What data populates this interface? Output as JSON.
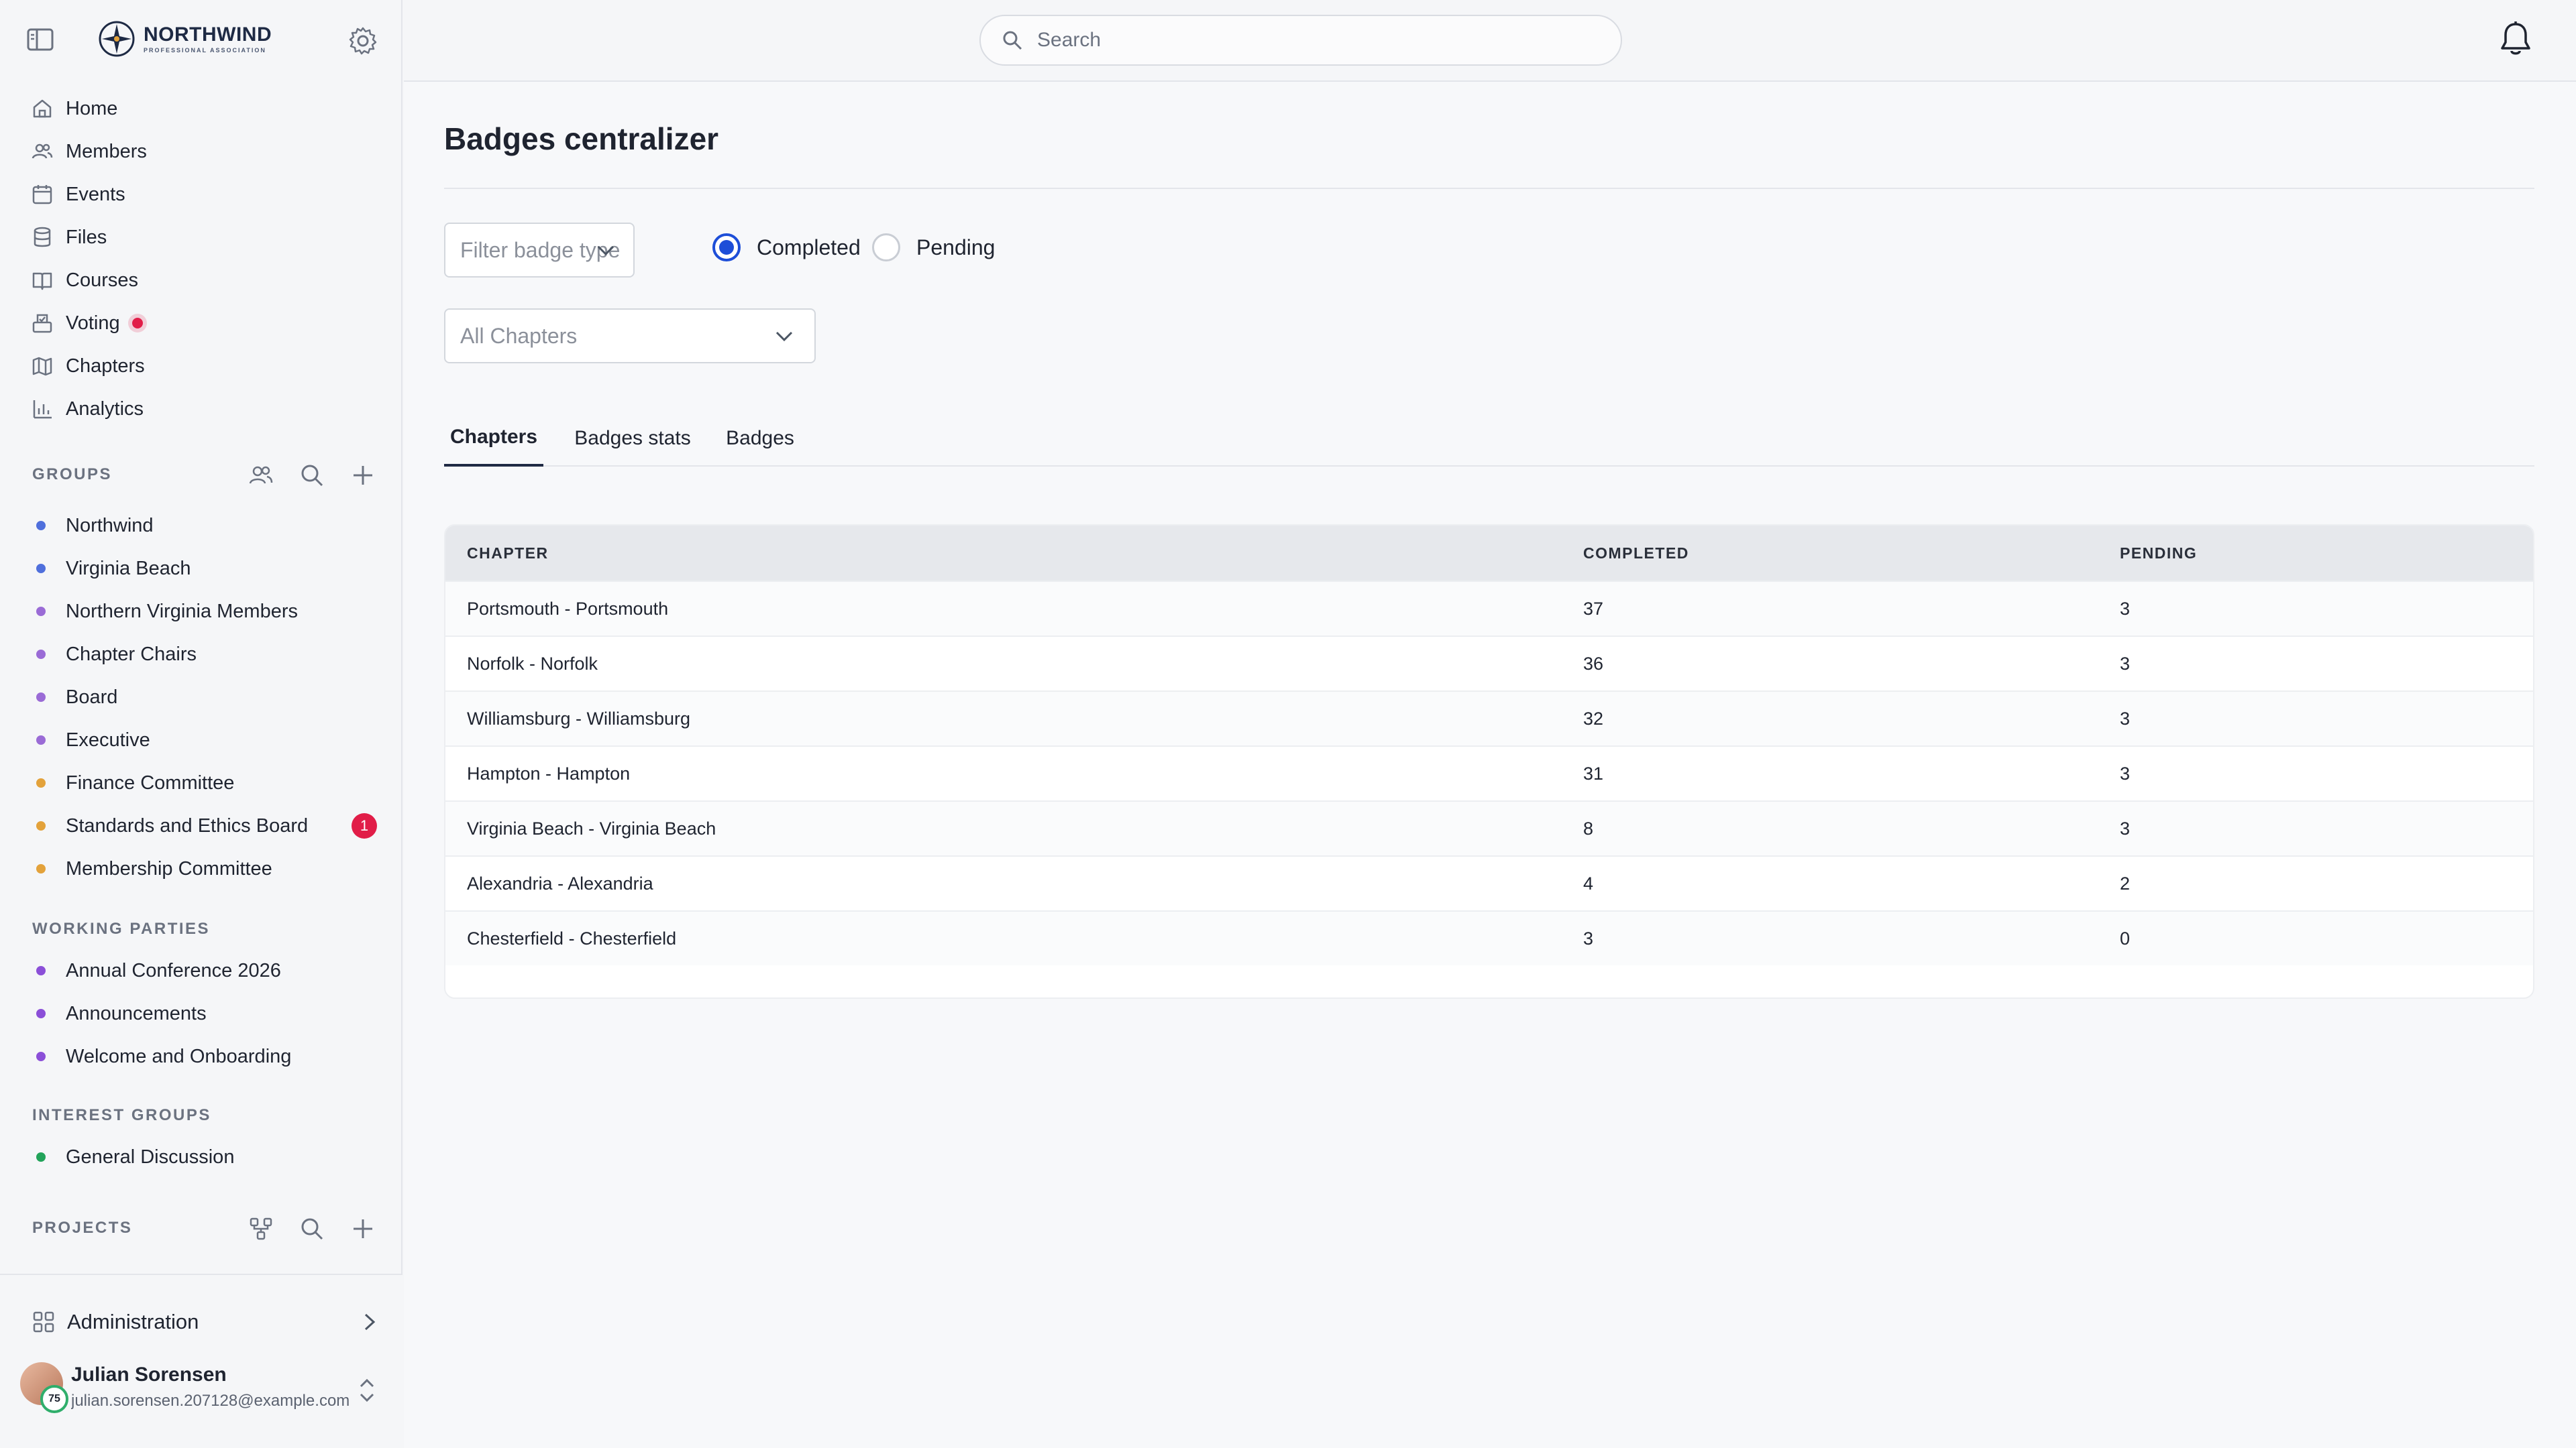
{
  "brand": {
    "name": "NORTHWIND",
    "subtitle": "PROFESSIONAL ASSOCIATION"
  },
  "search": {
    "placeholder": "Search"
  },
  "nav": [
    {
      "label": "Home",
      "icon": "home-icon"
    },
    {
      "label": "Members",
      "icon": "members-icon"
    },
    {
      "label": "Events",
      "icon": "calendar-icon"
    },
    {
      "label": "Files",
      "icon": "database-icon"
    },
    {
      "label": "Courses",
      "icon": "book-icon"
    },
    {
      "label": "Voting",
      "icon": "ballot-icon",
      "indicator": true
    },
    {
      "label": "Chapters",
      "icon": "map-icon"
    },
    {
      "label": "Analytics",
      "icon": "chart-icon"
    }
  ],
  "groups": {
    "heading": "GROUPS",
    "items": [
      {
        "label": "Northwind",
        "color": "#4f6fdc"
      },
      {
        "label": "Virginia Beach",
        "color": "#4f6fdc"
      },
      {
        "label": "Northern Virginia Members",
        "color": "#9a6bd6"
      },
      {
        "label": "Chapter Chairs",
        "color": "#9a6bd6"
      },
      {
        "label": "Board",
        "color": "#9a6bd6"
      },
      {
        "label": "Executive",
        "color": "#9a6bd6"
      },
      {
        "label": "Finance Committee",
        "color": "#e3a23b"
      },
      {
        "label": "Standards and Ethics Board",
        "color": "#e3a23b",
        "badge": "1"
      },
      {
        "label": "Membership Committee",
        "color": "#e3a23b"
      }
    ]
  },
  "working_parties": {
    "heading": "WORKING PARTIES",
    "items": [
      {
        "label": "Annual Conference 2026",
        "color": "#8b4fd8"
      },
      {
        "label": "Announcements",
        "color": "#8b4fd8"
      },
      {
        "label": "Welcome and Onboarding",
        "color": "#8b4fd8"
      }
    ]
  },
  "interest_groups": {
    "heading": "INTEREST GROUPS",
    "items": [
      {
        "label": "General Discussion",
        "color": "#22a35a"
      }
    ]
  },
  "projects": {
    "heading": "PROJECTS"
  },
  "admin": {
    "label": "Administration"
  },
  "user": {
    "name": "Julian Sorensen",
    "email": "julian.sorensen.207128@example.com",
    "score": "75"
  },
  "page": {
    "title": "Badges centralizer",
    "filter_badge_placeholder": "Filter badge type",
    "radio_completed": "Completed",
    "radio_pending": "Pending",
    "radio_selected": "Completed",
    "chapter_select": "All Chapters",
    "tabs": [
      "Chapters",
      "Badges stats",
      "Badges"
    ],
    "active_tab": "Chapters"
  },
  "table": {
    "headers": [
      "CHAPTER",
      "COMPLETED",
      "PENDING"
    ],
    "rows": [
      [
        "Portsmouth - Portsmouth",
        "37",
        "3"
      ],
      [
        "Norfolk - Norfolk",
        "36",
        "3"
      ],
      [
        "Williamsburg - Williamsburg",
        "32",
        "3"
      ],
      [
        "Hampton - Hampton",
        "31",
        "3"
      ],
      [
        "Virginia Beach - Virginia Beach",
        "8",
        "3"
      ],
      [
        "Alexandria - Alexandria",
        "4",
        "2"
      ],
      [
        "Chesterfield - Chesterfield",
        "3",
        "0"
      ]
    ]
  },
  "colors": {
    "accent": "#1d4ed8",
    "alert": "#e11d48"
  }
}
